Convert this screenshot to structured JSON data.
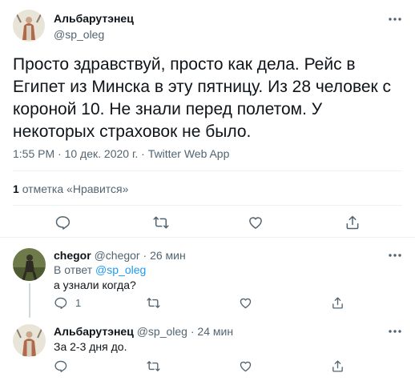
{
  "main_tweet": {
    "author_name": "Альбарутэнец",
    "author_handle": "@sp_oleg",
    "text": "Просто здравствуй, просто как дела. Рейс в Египет из Минска в эту пятницу. Из 28 человек с короной 10. Не знали перед полетом. У некоторых страховок не было.",
    "time": "1:55 PM",
    "date": "10 дек. 2020 г.",
    "source": "Twitter Web App",
    "separator": "·",
    "likes_count": "1",
    "likes_label": "отметка «Нравится»"
  },
  "replies": [
    {
      "author_name": "chegor",
      "author_handle": "@chegor",
      "separator": "·",
      "time_ago": "26 мин",
      "reply_to_label": "В ответ",
      "reply_to_handle": "@sp_oleg",
      "text": "а узнали когда?",
      "reply_count": "1"
    },
    {
      "author_name": "Альбарутэнец",
      "author_handle": "@sp_oleg",
      "separator": "·",
      "time_ago": "24 мин",
      "text": "За 2-3 дня до."
    }
  ],
  "icons": {
    "more": "more-horizontal-icon",
    "reply": "reply-bubble-icon",
    "retweet": "retweet-icon",
    "like": "heart-icon",
    "share": "share-upload-icon"
  },
  "colors": {
    "accent": "#1d9bf0",
    "text_primary": "#0f1419",
    "text_secondary": "#536471",
    "border": "#eff3f4"
  }
}
